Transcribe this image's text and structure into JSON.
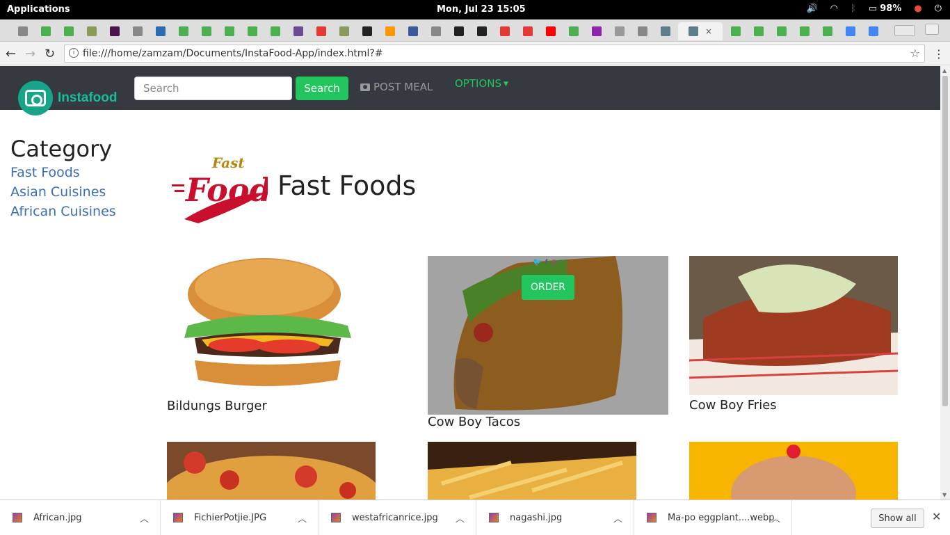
{
  "os": {
    "apps_label": "Applications",
    "clock": "Mon, Jul 23    15:05",
    "battery": "98%"
  },
  "browser": {
    "url": "file:///home/zamzam/Documents/InstaFood-App/index.html?#",
    "tab_favicons": [
      "doc",
      "w3",
      "w3",
      "tree",
      "hash",
      "doc",
      "SA",
      "w3",
      "w3",
      "w3",
      "w3",
      "w3",
      "bill",
      "F",
      "tree",
      "gh",
      "color",
      "fb",
      "doc",
      "gh",
      "gh",
      "red",
      "red",
      "yt",
      "w3",
      "olx",
      "Ne",
      "doc",
      "circle",
      "active",
      "w3",
      "w3",
      "w3",
      "w3",
      "w3",
      "G",
      "G",
      "Ne"
    ],
    "active_tab_close": "×"
  },
  "site": {
    "brand_name": "Instafood",
    "search_placeholder": "Search",
    "search_button": "Search",
    "post_meal": "POST MEAL",
    "options": "OPTIONS",
    "accent_color": "#22c55e",
    "nav_bg": "#343a40"
  },
  "sidebar": {
    "title": "Category",
    "items": [
      {
        "label": "Fast Foods"
      },
      {
        "label": "Asian Cuisines"
      },
      {
        "label": "African Cuisines"
      }
    ]
  },
  "main": {
    "logo_word1": "Fast",
    "logo_word2": "Food",
    "heading": "Fast Foods",
    "cards": [
      {
        "label": "Bildungs Burger"
      },
      {
        "label": "Cow Boy Tacos",
        "order": "ORDER"
      },
      {
        "label": "Cow Boy Fries"
      },
      {
        "label": ""
      },
      {
        "label": ""
      },
      {
        "label": ""
      }
    ]
  },
  "downloads": {
    "items": [
      {
        "name": "African.jpg"
      },
      {
        "name": "FichierPotjie.JPG"
      },
      {
        "name": "westafricanrice.jpg"
      },
      {
        "name": "nagashi.jpg"
      },
      {
        "name": "Ma-po eggplant....webp"
      }
    ],
    "show_all": "Show all"
  }
}
